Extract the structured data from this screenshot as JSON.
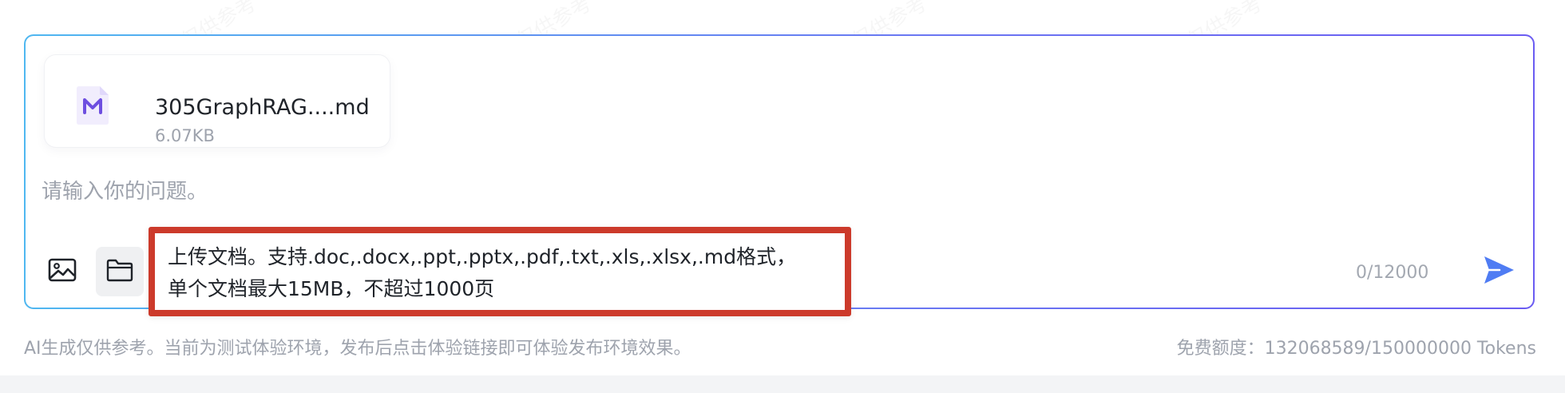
{
  "watermark": "AI生成内容仅供参考",
  "attachment": {
    "icon": "markdown-file-icon",
    "name": "305GraphRAG....md",
    "size": "6.07KB"
  },
  "input": {
    "placeholder": "请输入你的问题。",
    "value": ""
  },
  "toolbar": {
    "image_icon": "image-icon",
    "folder_icon": "folder-icon"
  },
  "tooltip": {
    "line1": "上传文档。支持.doc,.docx,.ppt,.pptx,.pdf,.txt,.xls,.xlsx,.md格式，",
    "line2": "单个文档最大15MB，不超过1000页"
  },
  "char_count": "0/12000",
  "send_icon": "send-icon",
  "footer": {
    "note": "AI生成仅供参考。当前为测试体验环境，发布后点击体验链接即可体验发布环境效果。",
    "quota": "免费额度：132068589/150000000 Tokens"
  },
  "colors": {
    "border_gradient_start": "#4fb7f0",
    "border_gradient_end": "#6b5cf2",
    "tooltip_border": "#cc3a2b",
    "send_accent": "#4f7cf3",
    "markdown_icon": "#6e4fe0"
  }
}
